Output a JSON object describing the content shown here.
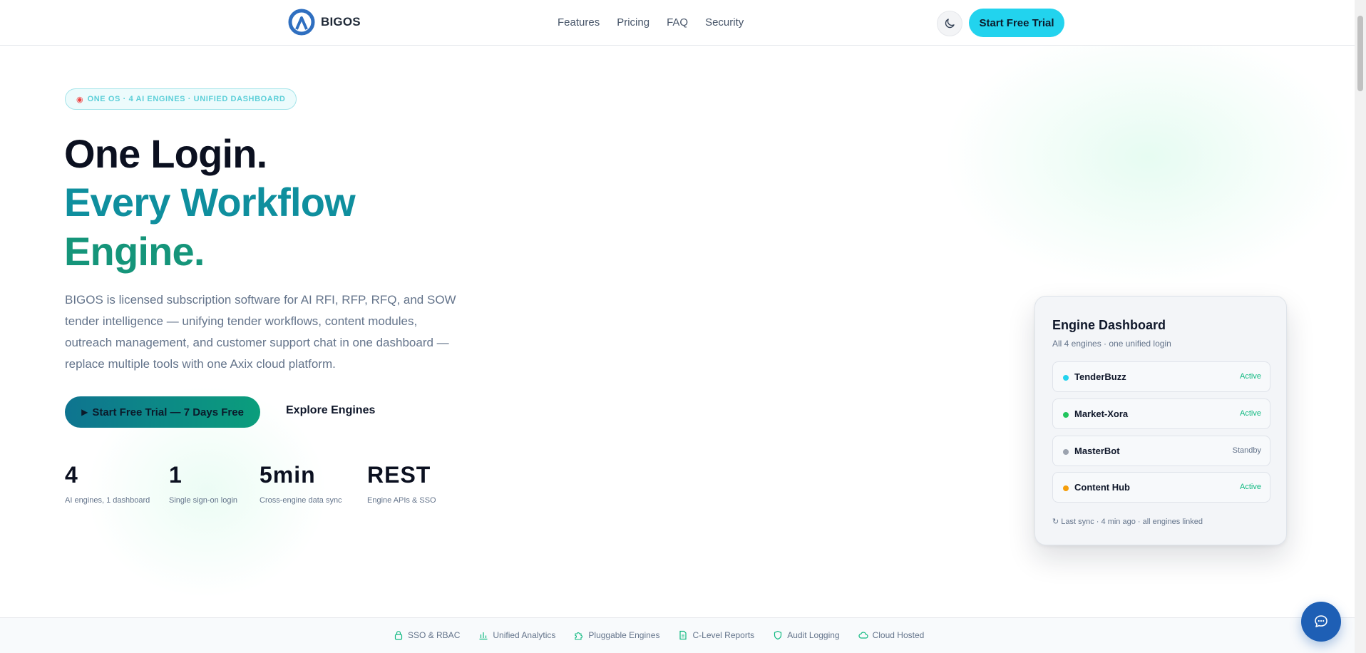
{
  "nav": {
    "brand": "BIGOS",
    "links": [
      "Features",
      "Pricing",
      "FAQ",
      "Security"
    ],
    "theme_toggle_icon": "moon-icon",
    "cta": "Start Free Trial"
  },
  "hero": {
    "badge_icon": "brain-icon",
    "badge": "ONE OS · 4 AI ENGINES · UNIFIED DASHBOARD",
    "headline_1": "One Login.",
    "headline_2": "Every Workflow",
    "headline_3": "Engine.",
    "description": "BIGOS is licensed subscription software for AI RFI, RFP, RFQ, and SOW tender intelligence — unifying tender workflows, content modules, outreach management, and customer support chat in one dashboard — replace multiple tools with one Axix cloud platform.",
    "cta_primary": "Start Free Trial — 7 Days Free",
    "cta_secondary": "Explore Engines",
    "stats": [
      {
        "value": "4",
        "label": "AI engines, 1 dashboard"
      },
      {
        "value": "1",
        "label": "Single sign-on login"
      },
      {
        "value": "5min",
        "label": "Cross-engine data sync"
      },
      {
        "value": "REST",
        "label": "Engine APIs & SSO"
      }
    ]
  },
  "dashboard": {
    "title": "Engine Dashboard",
    "subtitle": "All 4 engines · one unified login",
    "engines": [
      {
        "name": "TenderBuzz",
        "status": "Active",
        "dot_color": "#22d3ee",
        "status_color": "#10b981"
      },
      {
        "name": "Market-Xora",
        "status": "Active",
        "dot_color": "#22c55e",
        "status_color": "#10b981"
      },
      {
        "name": "MasterBot",
        "status": "Standby",
        "dot_color": "#9ca3af",
        "status_color": "#64748b"
      },
      {
        "name": "Content Hub",
        "status": "Active",
        "dot_color": "#f59e0b",
        "status_color": "#10b981"
      }
    ],
    "footer": "↻ Last sync · 4 min ago · all engines linked"
  },
  "features": [
    {
      "icon": "lock-icon",
      "label": "SSO & RBAC"
    },
    {
      "icon": "bar-chart-icon",
      "label": "Unified Analytics"
    },
    {
      "icon": "puzzle-icon",
      "label": "Pluggable Engines"
    },
    {
      "icon": "document-icon",
      "label": "C-Level Reports"
    },
    {
      "icon": "shield-icon",
      "label": "Audit Logging"
    },
    {
      "icon": "cloud-icon",
      "label": "Cloud Hosted"
    }
  ],
  "chat": {
    "icon": "chat-bubble-icon"
  },
  "colors": {
    "accent": "#22d3ee",
    "teal": "#0f8f9e",
    "green": "#15957a",
    "chat": "#1e5fb5"
  }
}
